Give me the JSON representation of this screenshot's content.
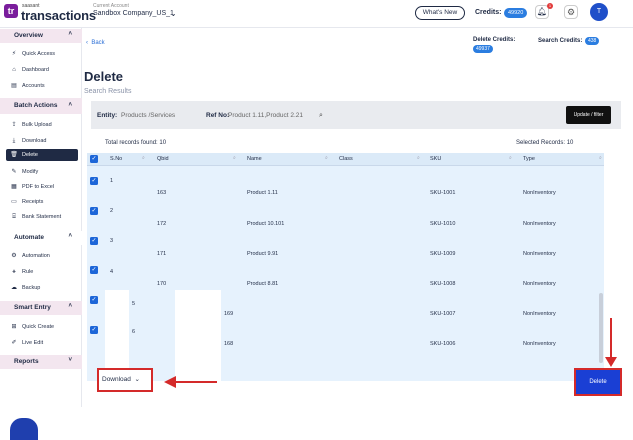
{
  "header": {
    "brand_small": "saasant",
    "brand_name": "transactions",
    "account_label": "Current Account",
    "account_name": "Sandbox Company_US_1",
    "whats_new": "What's New",
    "credits_label": "Credits:",
    "credits_value": "49920",
    "notif_count": "1",
    "avatar_initial": "T"
  },
  "sidebar": {
    "overview": "Overview",
    "quick_access": "Quick Access",
    "dashboard": "Dashboard",
    "accounts": "Accounts",
    "batch_actions": "Batch Actions",
    "bulk_upload": "Bulk Upload",
    "download": "Download",
    "delete": "Delete",
    "modify": "Modify",
    "pdf_to_excel": "PDF to Excel",
    "receipts": "Receipts",
    "bank_statement": "Bank Statement",
    "automate": "Automate",
    "automation": "Automation",
    "rule": "Rule",
    "backup": "Backup",
    "smart_entry": "Smart Entry",
    "quick_create": "Quick Create",
    "live_edit": "Live Edit",
    "reports": "Reports"
  },
  "main": {
    "back": "Back",
    "delete_credits_label": "Delete Credits:",
    "delete_credits_value": "49937",
    "search_credits_label": "Search Credits:",
    "search_credits_value": "438",
    "title": "Delete",
    "subtitle": "Search Results",
    "entity_label": "Entity:",
    "entity_value": "Products /Services",
    "ref_label": "Ref No:",
    "ref_value": "Product 1.11,Product 2.21",
    "update_filter": "Update / filter",
    "total_records": "Total records found: 10",
    "selected_records": "Selected Records: 10",
    "download_btn": "Download",
    "delete_btn": "Delete"
  },
  "table": {
    "headers": [
      "S.No",
      "Qbid",
      "Name",
      "Class",
      "SKU",
      "Type"
    ],
    "rows": [
      {
        "sno": "1",
        "qbid": "163",
        "name": "Product 1.11",
        "class": "",
        "sku": "SKU-1001",
        "type": "NonInventory"
      },
      {
        "sno": "2",
        "qbid": "172",
        "name": "Product 10.101",
        "class": "",
        "sku": "SKU-1010",
        "type": "NonInventory"
      },
      {
        "sno": "3",
        "qbid": "171",
        "name": "Product 9.91",
        "class": "",
        "sku": "SKU-1009",
        "type": "NonInventory"
      },
      {
        "sno": "4",
        "qbid": "170",
        "name": "Product 8.81",
        "class": "",
        "sku": "SKU-1008",
        "type": "NonInventory"
      },
      {
        "sno": "5",
        "qbid": "169",
        "name": "",
        "class": "",
        "sku": "SKU-1007",
        "type": "NonInventory"
      },
      {
        "sno": "6",
        "qbid": "168",
        "name": "",
        "class": "",
        "sku": "SKU-1006",
        "type": "NonInventory"
      }
    ]
  },
  "icons": {
    "sort": "sort-icon",
    "search": "search-icon",
    "chevron": "chevron-down-icon"
  },
  "colors": {
    "accent": "#2b7de0",
    "sidebar_active": "#1f2a44",
    "delete_button": "#1a3fd4",
    "annotation_red": "#d42a2a"
  }
}
